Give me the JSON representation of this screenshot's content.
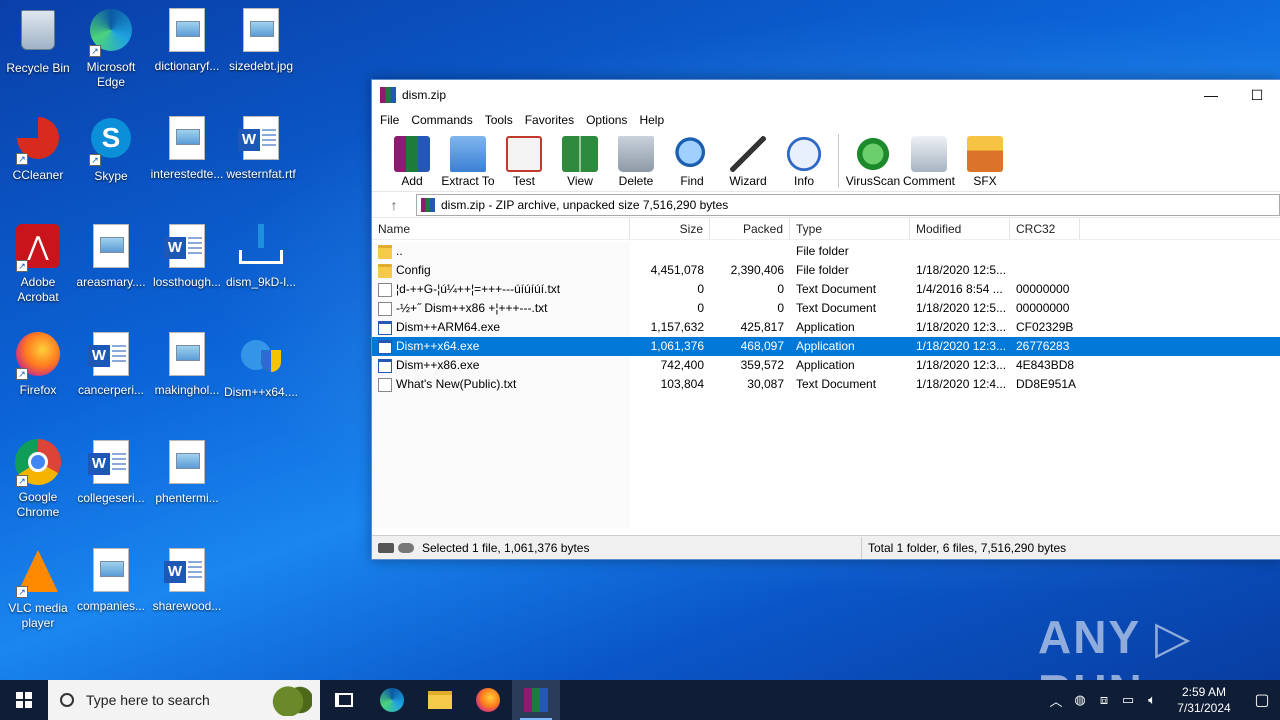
{
  "desktop": {
    "icons": [
      {
        "label": "Recycle Bin",
        "icon": "recycle-bin-icon"
      },
      {
        "label": "Microsoft Edge",
        "icon": "edge-icon"
      },
      {
        "label": "dictionaryf...",
        "icon": "image-file-icon"
      },
      {
        "label": "sizedebt.jpg",
        "icon": "image-file-icon"
      },
      {
        "label": "CCleaner",
        "icon": "ccleaner-icon"
      },
      {
        "label": "Skype",
        "icon": "skype-icon"
      },
      {
        "label": "interestedte...",
        "icon": "image-file-icon"
      },
      {
        "label": "westernfat.rtf",
        "icon": "word-doc-icon"
      },
      {
        "label": "Adobe Acrobat",
        "icon": "acrobat-icon"
      },
      {
        "label": "areasmary....",
        "icon": "image-file-icon"
      },
      {
        "label": "lossthough...",
        "icon": "word-doc-icon"
      },
      {
        "label": "dism_9kD-l...",
        "icon": "download-icon"
      },
      {
        "label": "Firefox",
        "icon": "firefox-icon"
      },
      {
        "label": "cancerperi...",
        "icon": "word-doc-icon"
      },
      {
        "label": "makinghol...",
        "icon": "image-file-icon"
      },
      {
        "label": "Dism++x64....",
        "icon": "dism-shield-icon"
      },
      {
        "label": "Google Chrome",
        "icon": "chrome-icon"
      },
      {
        "label": "collegeseri...",
        "icon": "word-doc-icon"
      },
      {
        "label": "phentermi...",
        "icon": "image-file-icon"
      },
      {
        "label": "VLC media player",
        "icon": "vlc-icon"
      },
      {
        "label": "companies...",
        "icon": "image-file-icon"
      },
      {
        "label": "sharewood...",
        "icon": "word-doc-icon"
      }
    ]
  },
  "window": {
    "title": "dism.zip",
    "minimize": "—",
    "maximize": "☐",
    "menu": [
      "File",
      "Commands",
      "Tools",
      "Favorites",
      "Options",
      "Help"
    ],
    "toolbar": [
      {
        "label": "Add",
        "icon": "add-archive-icon"
      },
      {
        "label": "Extract To",
        "icon": "extract-folder-icon"
      },
      {
        "label": "Test",
        "icon": "test-icon"
      },
      {
        "label": "View",
        "icon": "view-book-icon"
      },
      {
        "label": "Delete",
        "icon": "trash-icon"
      },
      {
        "label": "Find",
        "icon": "magnifier-icon"
      },
      {
        "label": "Wizard",
        "icon": "wand-icon"
      },
      {
        "label": "Info",
        "icon": "info-icon"
      },
      {
        "label": "VirusScan",
        "icon": "virus-scan-icon"
      },
      {
        "label": "Comment",
        "icon": "comment-icon"
      },
      {
        "label": "SFX",
        "icon": "sfx-box-icon"
      }
    ],
    "address": "dism.zip - ZIP archive, unpacked size 7,516,290 bytes",
    "columns": {
      "name": "Name",
      "size": "Size",
      "packed": "Packed",
      "type": "Type",
      "modified": "Modified",
      "crc": "CRC32"
    },
    "files": [
      {
        "name": "..",
        "size": "",
        "packed": "",
        "type": "File folder",
        "modified": "",
        "crc": "",
        "kind": "folder"
      },
      {
        "name": "Config",
        "size": "4,451,078",
        "packed": "2,390,406",
        "type": "File folder",
        "modified": "1/18/2020 12:5...",
        "crc": "",
        "kind": "folder"
      },
      {
        "name": "¦d-++G-¦ú¼++¦=+++---úíúíúí.txt",
        "size": "0",
        "packed": "0",
        "type": "Text Document",
        "modified": "1/4/2016 8:54 ...",
        "crc": "00000000",
        "kind": "txt"
      },
      {
        "name": "-½+˝ Dism++x86 +¦+++---.txt",
        "size": "0",
        "packed": "0",
        "type": "Text Document",
        "modified": "1/18/2020 12:5...",
        "crc": "00000000",
        "kind": "txt"
      },
      {
        "name": "Dism++ARM64.exe",
        "size": "1,157,632",
        "packed": "425,817",
        "type": "Application",
        "modified": "1/18/2020 12:3...",
        "crc": "CF02329B",
        "kind": "exe"
      },
      {
        "name": "Dism++x64.exe",
        "size": "1,061,376",
        "packed": "468,097",
        "type": "Application",
        "modified": "1/18/2020 12:3...",
        "crc": "26776283",
        "kind": "exe",
        "selected": true
      },
      {
        "name": "Dism++x86.exe",
        "size": "742,400",
        "packed": "359,572",
        "type": "Application",
        "modified": "1/18/2020 12:3...",
        "crc": "4E843BD8",
        "kind": "exe"
      },
      {
        "name": "What's New(Public).txt",
        "size": "103,804",
        "packed": "30,087",
        "type": "Text Document",
        "modified": "1/18/2020 12:4...",
        "crc": "DD8E951A",
        "kind": "txt"
      }
    ],
    "status_left": "Selected 1 file, 1,061,376 bytes",
    "status_right": "Total 1 folder, 6 files, 7,516,290 bytes"
  },
  "watermark": "ANY ▷ RUN",
  "taskbar": {
    "search_placeholder": "Type here to search",
    "apps": [
      "task-view-icon",
      "edge-icon",
      "file-explorer-icon",
      "firefox-icon",
      "winrar-icon"
    ],
    "time": "2:59 AM",
    "date": "7/31/2024"
  }
}
